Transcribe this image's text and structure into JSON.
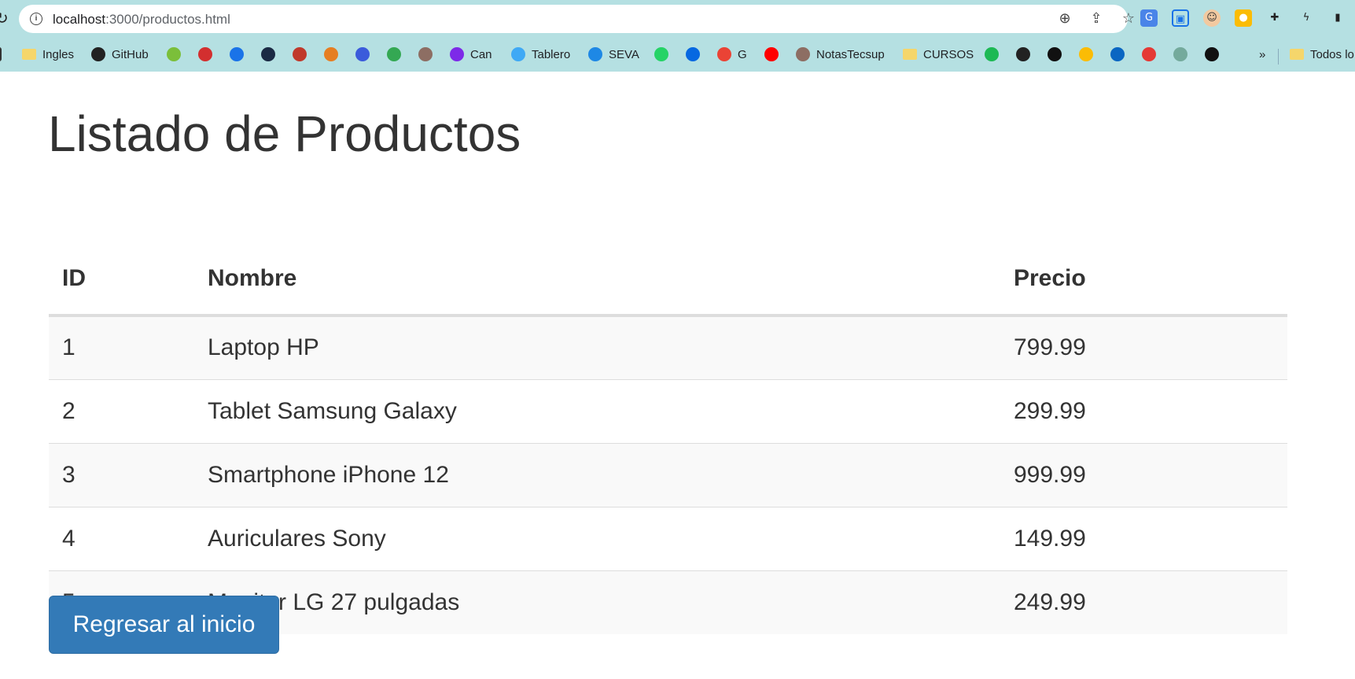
{
  "browser": {
    "url_host": "localhost",
    "url_path": ":3000/productos.html",
    "bookmarks": [
      {
        "label": "Ingles",
        "kind": "folder"
      },
      {
        "label": "GitHub",
        "kind": "site",
        "color": "#222222"
      },
      {
        "label": "",
        "kind": "site",
        "color": "#7bbf3a"
      },
      {
        "label": "",
        "kind": "site",
        "color": "#d32f2f"
      },
      {
        "label": "",
        "kind": "site",
        "color": "#1a73e8"
      },
      {
        "label": "",
        "kind": "site",
        "color": "#1b2a44"
      },
      {
        "label": "",
        "kind": "site",
        "color": "#c0392b"
      },
      {
        "label": "",
        "kind": "site",
        "color": "#e67e22"
      },
      {
        "label": "",
        "kind": "site",
        "color": "#3b5bdb"
      },
      {
        "label": "",
        "kind": "site",
        "color": "#34a853"
      },
      {
        "label": "",
        "kind": "site",
        "color": "#8d6e63"
      },
      {
        "label": "Can",
        "kind": "site",
        "color": "#7d2ae8"
      },
      {
        "label": "Tablero",
        "kind": "site",
        "color": "#3fa9f5"
      },
      {
        "label": "SEVA",
        "kind": "site",
        "color": "#1e88e5"
      },
      {
        "label": "",
        "kind": "site",
        "color": "#25d366"
      },
      {
        "label": "",
        "kind": "site",
        "color": "#0668e1"
      },
      {
        "label": "G",
        "kind": "site",
        "color": "#ea4335"
      },
      {
        "label": "",
        "kind": "site",
        "color": "#ff0000"
      },
      {
        "label": "NotasTecsup",
        "kind": "site",
        "color": "#8d6e63"
      },
      {
        "label": "CURSOS",
        "kind": "folder"
      },
      {
        "label": "",
        "kind": "site",
        "color": "#1db954"
      },
      {
        "label": "",
        "kind": "site",
        "color": "#222222"
      },
      {
        "label": "",
        "kind": "site",
        "color": "#111111"
      },
      {
        "label": "",
        "kind": "site",
        "color": "#fbbc05"
      },
      {
        "label": "",
        "kind": "site",
        "color": "#0a66c2"
      },
      {
        "label": "",
        "kind": "site",
        "color": "#e53935"
      },
      {
        "label": "",
        "kind": "site",
        "color": "#74aa9c"
      },
      {
        "label": "",
        "kind": "site",
        "color": "#111111"
      }
    ],
    "overflow_label": "»",
    "all_bookmarks_label": "Todos lo"
  },
  "page": {
    "title": "Listado de Productos",
    "table": {
      "headers": [
        "ID",
        "Nombre",
        "Precio"
      ],
      "rows": [
        [
          "1",
          "Laptop HP",
          "799.99"
        ],
        [
          "2",
          "Tablet Samsung Galaxy",
          "299.99"
        ],
        [
          "3",
          "Smartphone iPhone 12",
          "999.99"
        ],
        [
          "4",
          "Auriculares Sony",
          "149.99"
        ],
        [
          "5",
          "Monitor LG 27 pulgadas",
          "249.99"
        ]
      ]
    },
    "back_button_label": "Regresar al inicio"
  },
  "colors": {
    "chrome_bg": "#b5e0e2",
    "button_bg": "#337ab7",
    "stripe": "#f9f9f9"
  }
}
